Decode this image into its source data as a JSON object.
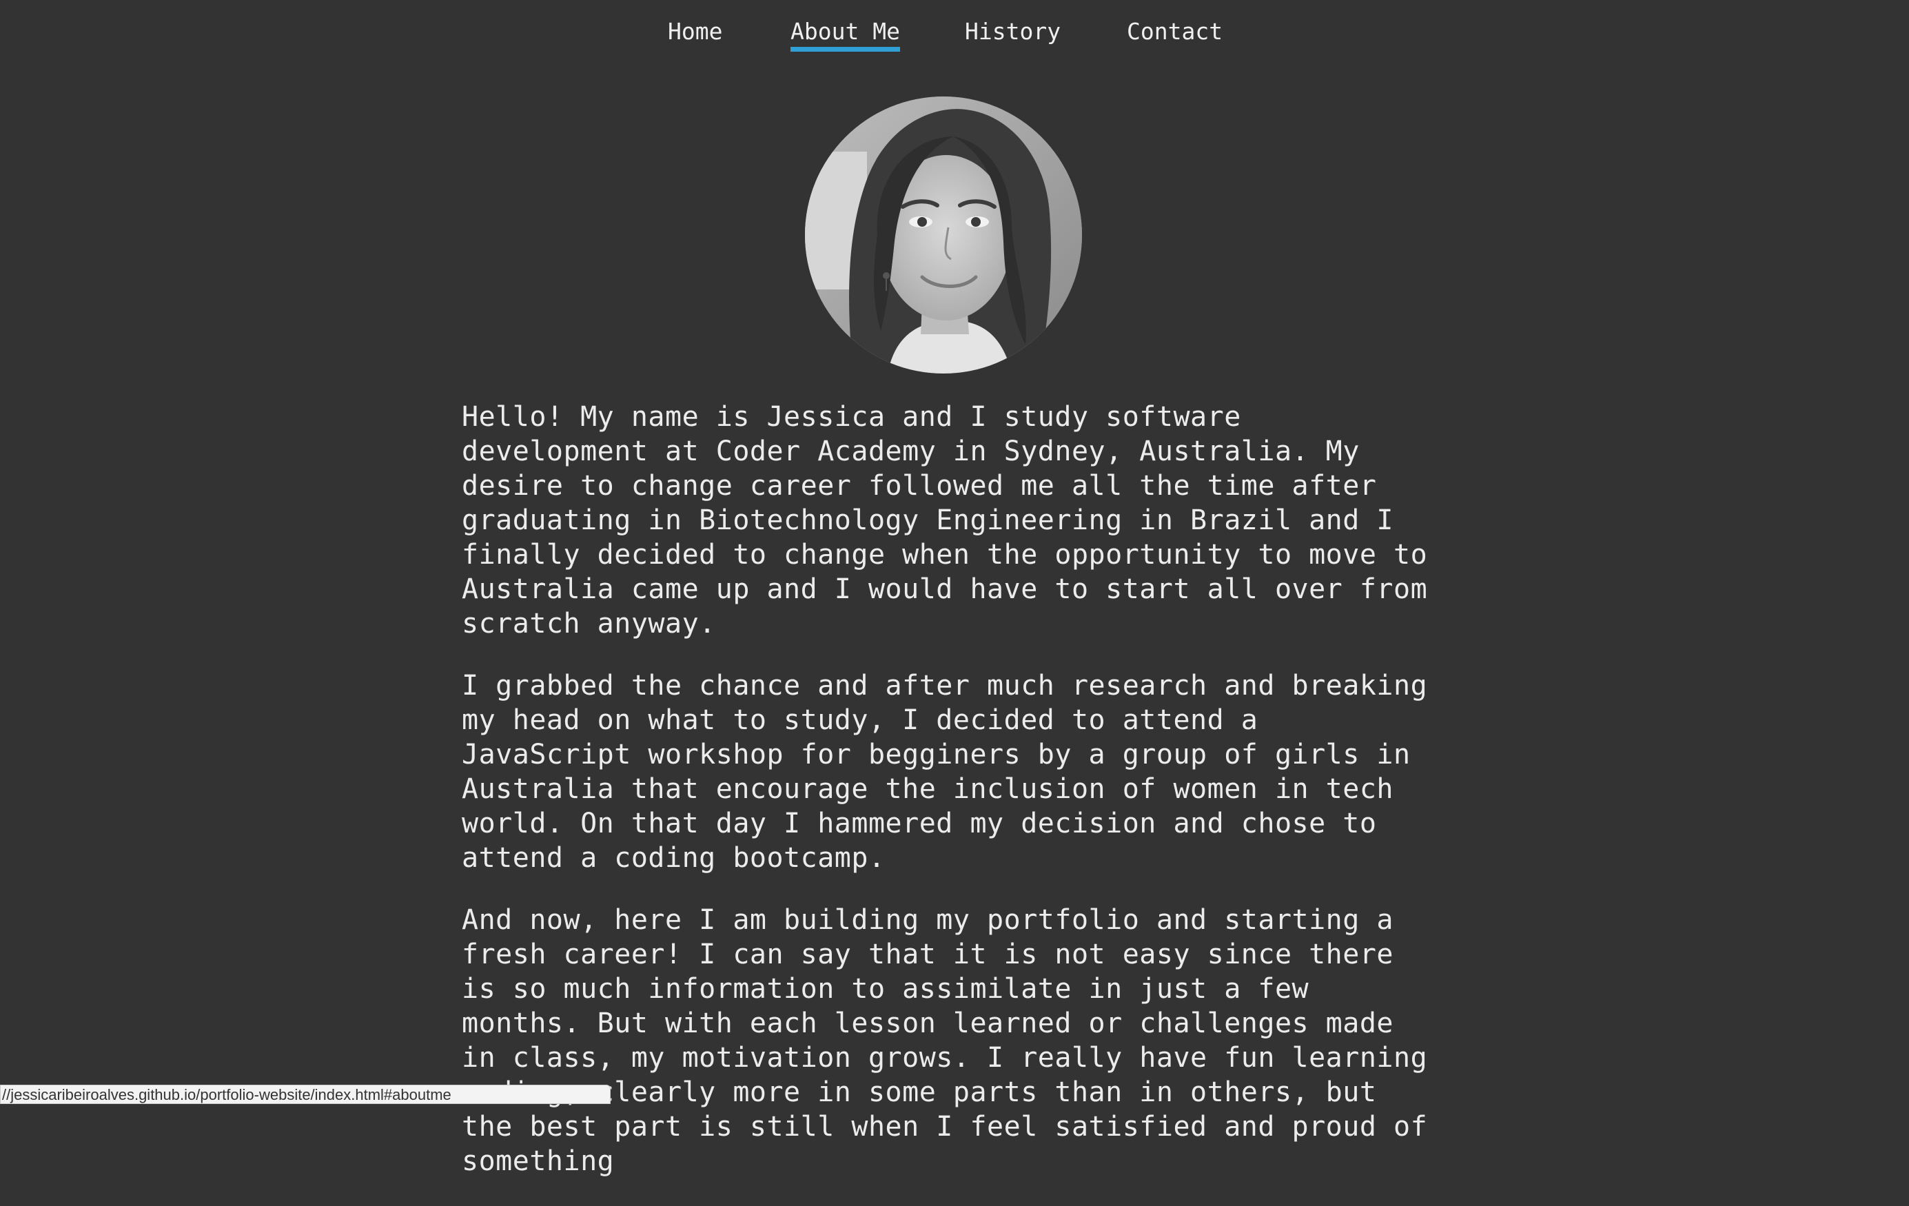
{
  "nav": {
    "items": [
      {
        "label": "Home",
        "active": false
      },
      {
        "label": "About Me",
        "active": true
      },
      {
        "label": "History",
        "active": false
      },
      {
        "label": "Contact",
        "active": false
      }
    ],
    "active_underline_color": "#2f9fd6"
  },
  "about": {
    "paragraphs": [
      "Hello! My name is Jessica and I study software development at Coder Academy in Sydney, Australia. My desire to change career followed me all the time after graduating in Biotechnology Engineering in Brazil and I finally decided to change when the opportunity to move to Australia came up and I would have to start all over from scratch anyway.",
      "I grabbed the chance and after much research and breaking my head on what to study, I decided to attend a JavaScript workshop for begginers by a group of girls in Australia that encourage the inclusion of women in tech world. On that day I hammered my decision and chose to attend a coding bootcamp.",
      "And now, here I am building my portfolio and starting a fresh career! I can say that it is not easy since there is so much information to assimilate in just a few months. But with each lesson learned or challenges made in class, my motivation grows. I really have fun learning coding, clearly more in some parts than in others, but the best part is still when I feel satisfied and proud of something"
    ]
  },
  "status_bar": {
    "url": "//jessicaribeiroalves.github.io/portfolio-website/index.html#aboutme"
  },
  "colors": {
    "background": "#333333",
    "text": "#e8e8e8",
    "accent": "#2f9fd6"
  }
}
